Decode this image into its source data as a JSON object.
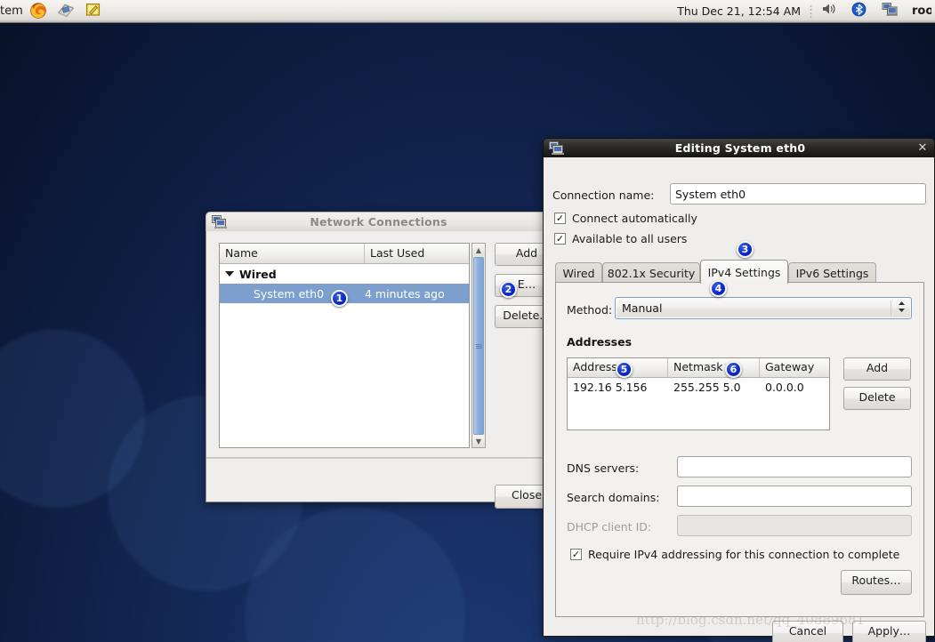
{
  "panel": {
    "menu_label": "tem",
    "icons": [
      "firefox-icon",
      "mail-archive-icon",
      "notes-icon"
    ],
    "clock": "Thu Dec 21, 12:54 AM",
    "tray_icons": [
      "volume-icon",
      "bluetooth-icon",
      "display-network-icon"
    ],
    "username": "roo"
  },
  "network_window": {
    "title": "Network Connections",
    "columns": {
      "name": "Name",
      "last_used": "Last Used"
    },
    "group": "Wired",
    "connection": {
      "name": "System eth0",
      "last_used": "4 minutes ago"
    },
    "buttons": {
      "add": "Add",
      "edit": "E…",
      "delete": "Delete…",
      "close": "Close"
    }
  },
  "edit_dialog": {
    "title": "Editing System eth0",
    "close_glyph": "✕",
    "connection_name_label": "Connection name:",
    "connection_name_value": "System eth0",
    "connect_automatically": "Connect automatically",
    "available_to_all_users": "Available to all users",
    "checked_glyph": "✓",
    "tabs": [
      {
        "label": "Wired",
        "active": false
      },
      {
        "label": "802.1x Security",
        "active": false
      },
      {
        "label": "IPv4 Settings",
        "active": true
      },
      {
        "label": "IPv6 Settings",
        "active": false
      }
    ],
    "method_label": "Method:",
    "method_value": "Manual",
    "method_arrows": "⌃⌄",
    "addresses_label": "Addresses",
    "address_columns": {
      "address": "Address",
      "netmask": "Netmask",
      "gateway": "Gateway"
    },
    "address_rows": [
      {
        "address": "192.16 5.156",
        "netmask": "255.255 5.0",
        "gateway": "0.0.0.0"
      }
    ],
    "addr_buttons": {
      "add": "Add",
      "delete": "Delete"
    },
    "dns_label": "DNS servers:",
    "dns_value": "",
    "search_label": "Search domains:",
    "search_value": "",
    "dhcp_label": "DHCP client ID:",
    "dhcp_value": "",
    "require_ipv4": "Require IPv4 addressing for this connection to complete",
    "routes_button": "Routes…",
    "cancel_button": "Cancel",
    "apply_button": "Apply…"
  },
  "badges": [
    {
      "n": "1"
    },
    {
      "n": "2"
    },
    {
      "n": "3"
    },
    {
      "n": "4"
    },
    {
      "n": "5"
    },
    {
      "n": "6"
    }
  ],
  "watermark": "http://blog.csdn.net/qq_40889681",
  "colors": {
    "selection_blue": "#7d9fcd",
    "badge_blue": "#0a27c9",
    "desktop_navy": "#162c5c"
  }
}
